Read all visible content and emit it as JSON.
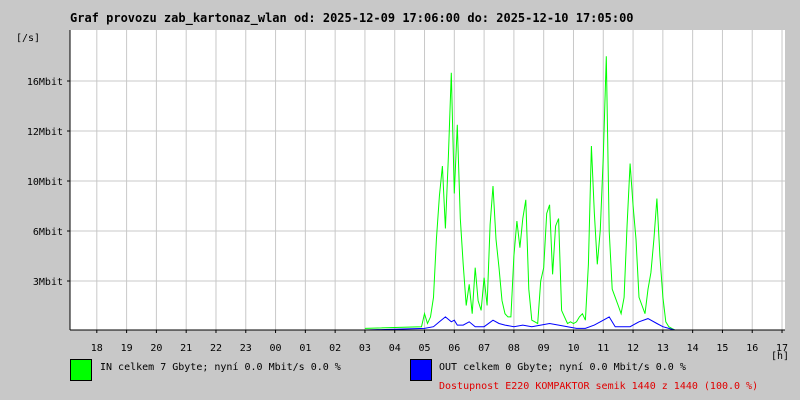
{
  "chart_data": {
    "type": "line",
    "title": "Graf provozu zab_kartonaz_wlan od: 2025-12-09 17:06:00 do: 2025-12-10 17:05:00",
    "ylabel": "[/s]",
    "xlabel": "[h]",
    "x_ticks": [
      "18",
      "19",
      "20",
      "21",
      "22",
      "23",
      "00",
      "01",
      "02",
      "03",
      "04",
      "05",
      "06",
      "07",
      "08",
      "09",
      "10",
      "11",
      "12",
      "13",
      "14",
      "15",
      "16",
      "17"
    ],
    "y_ticks": [
      {
        "value": 3,
        "label": "3Mbit"
      },
      {
        "value": 6,
        "label": "6Mbit"
      },
      {
        "value": 10,
        "label": "10Mbit"
      },
      {
        "value": 12,
        "label": "12Mbit"
      },
      {
        "value": 16,
        "label": "16Mbit"
      }
    ],
    "x_range_hours": [
      17.1,
      41.1
    ],
    "y_unit": "Mbit/s",
    "grid": true,
    "series": [
      {
        "name": "IN",
        "color": "#00ff00",
        "x_hours": [
          27.0,
          28.9,
          29.0,
          29.1,
          29.2,
          29.3,
          29.4,
          29.5,
          29.6,
          29.7,
          29.8,
          29.9,
          30.0,
          30.1,
          30.2,
          30.3,
          30.4,
          30.5,
          30.6,
          30.7,
          30.8,
          30.9,
          31.0,
          31.1,
          31.2,
          31.3,
          31.4,
          31.5,
          31.6,
          31.7,
          31.8,
          31.9,
          32.0,
          32.1,
          32.2,
          32.3,
          32.4,
          32.5,
          32.6,
          32.7,
          32.8,
          32.9,
          33.0,
          33.1,
          33.2,
          33.3,
          33.4,
          33.5,
          33.6,
          33.7,
          33.8,
          33.9,
          34.0,
          34.1,
          34.2,
          34.3,
          34.4,
          34.5,
          34.6,
          34.7,
          34.8,
          34.9,
          35.0,
          35.1,
          35.2,
          35.3,
          35.4,
          35.5,
          35.6,
          35.7,
          35.8,
          35.9,
          36.0,
          36.1,
          36.2,
          36.3,
          36.4,
          36.5,
          36.6,
          36.7,
          36.8,
          36.9,
          37.0,
          37.1,
          37.2,
          37.3,
          37.4
        ],
        "values": [
          0.1,
          0.2,
          1.0,
          0.4,
          0.8,
          2.0,
          5.5,
          8.8,
          10.6,
          6.2,
          11.0,
          16.5,
          9.0,
          12.5,
          7.0,
          4.0,
          1.5,
          2.8,
          1.0,
          3.8,
          1.8,
          1.2,
          3.2,
          1.5,
          6.5,
          9.6,
          5.5,
          3.8,
          1.8,
          1.0,
          0.8,
          0.8,
          4.5,
          6.8,
          5.0,
          7.0,
          8.5,
          2.5,
          0.6,
          0.5,
          0.4,
          3.0,
          3.8,
          7.4,
          8.1,
          3.4,
          6.4,
          7.0,
          1.2,
          0.8,
          0.4,
          0.5,
          0.4,
          0.5,
          0.8,
          1.0,
          0.6,
          4.0,
          11.4,
          7.5,
          4.0,
          6.1,
          11.0,
          17.5,
          6.0,
          2.5,
          2.0,
          1.5,
          1.0,
          2.0,
          6.5,
          10.7,
          8.0,
          5.5,
          2.0,
          1.5,
          1.0,
          2.5,
          3.5,
          5.5,
          8.6,
          4.5,
          2.0,
          0.5,
          0.2,
          0.1,
          0.0
        ]
      },
      {
        "name": "OUT",
        "color": "#0000ff",
        "x_hours": [
          27.0,
          29.0,
          29.3,
          29.5,
          29.7,
          29.9,
          30.0,
          30.1,
          30.3,
          30.5,
          30.7,
          31.0,
          31.3,
          31.5,
          31.7,
          32.0,
          32.3,
          32.6,
          32.9,
          33.2,
          33.5,
          33.8,
          34.1,
          34.4,
          34.7,
          35.0,
          35.2,
          35.4,
          35.7,
          35.9,
          36.2,
          36.5,
          36.8,
          37.0,
          37.2,
          37.4
        ],
        "values": [
          0.0,
          0.1,
          0.2,
          0.5,
          0.8,
          0.5,
          0.6,
          0.3,
          0.3,
          0.5,
          0.2,
          0.2,
          0.6,
          0.4,
          0.3,
          0.2,
          0.3,
          0.2,
          0.3,
          0.4,
          0.3,
          0.2,
          0.1,
          0.1,
          0.3,
          0.6,
          0.8,
          0.2,
          0.2,
          0.2,
          0.5,
          0.7,
          0.4,
          0.2,
          0.1,
          0.0
        ]
      }
    ]
  },
  "legend": {
    "in_text": "IN celkem 7 Gbyte; nyní   0.0 Mbit/s 0.0 %",
    "out_text": "OUT celkem 0 Gbyte; nyní   0.0 Mbit/s 0.0 %",
    "in_color": "#00ff00",
    "out_color": "#0000ff"
  },
  "availability": "Dostupnost E220 KOMPAKTOR semik 1440 z 1440 (100.0 %)",
  "colors": {
    "background": "#c8c8c8",
    "plot_bg": "#ffffff",
    "grid": "#c8c8c8",
    "availability_text": "#e00000"
  }
}
